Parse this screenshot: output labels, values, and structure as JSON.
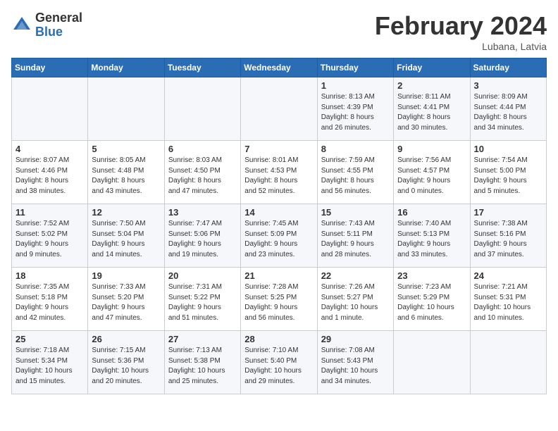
{
  "header": {
    "logo_general": "General",
    "logo_blue": "Blue",
    "month_title": "February 2024",
    "subtitle": "Lubana, Latvia"
  },
  "days_of_week": [
    "Sunday",
    "Monday",
    "Tuesday",
    "Wednesday",
    "Thursday",
    "Friday",
    "Saturday"
  ],
  "weeks": [
    {
      "days": [
        {
          "number": "",
          "info": ""
        },
        {
          "number": "",
          "info": ""
        },
        {
          "number": "",
          "info": ""
        },
        {
          "number": "",
          "info": ""
        },
        {
          "number": "1",
          "info": "Sunrise: 8:13 AM\nSunset: 4:39 PM\nDaylight: 8 hours\nand 26 minutes."
        },
        {
          "number": "2",
          "info": "Sunrise: 8:11 AM\nSunset: 4:41 PM\nDaylight: 8 hours\nand 30 minutes."
        },
        {
          "number": "3",
          "info": "Sunrise: 8:09 AM\nSunset: 4:44 PM\nDaylight: 8 hours\nand 34 minutes."
        }
      ]
    },
    {
      "days": [
        {
          "number": "4",
          "info": "Sunrise: 8:07 AM\nSunset: 4:46 PM\nDaylight: 8 hours\nand 38 minutes."
        },
        {
          "number": "5",
          "info": "Sunrise: 8:05 AM\nSunset: 4:48 PM\nDaylight: 8 hours\nand 43 minutes."
        },
        {
          "number": "6",
          "info": "Sunrise: 8:03 AM\nSunset: 4:50 PM\nDaylight: 8 hours\nand 47 minutes."
        },
        {
          "number": "7",
          "info": "Sunrise: 8:01 AM\nSunset: 4:53 PM\nDaylight: 8 hours\nand 52 minutes."
        },
        {
          "number": "8",
          "info": "Sunrise: 7:59 AM\nSunset: 4:55 PM\nDaylight: 8 hours\nand 56 minutes."
        },
        {
          "number": "9",
          "info": "Sunrise: 7:56 AM\nSunset: 4:57 PM\nDaylight: 9 hours\nand 0 minutes."
        },
        {
          "number": "10",
          "info": "Sunrise: 7:54 AM\nSunset: 5:00 PM\nDaylight: 9 hours\nand 5 minutes."
        }
      ]
    },
    {
      "days": [
        {
          "number": "11",
          "info": "Sunrise: 7:52 AM\nSunset: 5:02 PM\nDaylight: 9 hours\nand 9 minutes."
        },
        {
          "number": "12",
          "info": "Sunrise: 7:50 AM\nSunset: 5:04 PM\nDaylight: 9 hours\nand 14 minutes."
        },
        {
          "number": "13",
          "info": "Sunrise: 7:47 AM\nSunset: 5:06 PM\nDaylight: 9 hours\nand 19 minutes."
        },
        {
          "number": "14",
          "info": "Sunrise: 7:45 AM\nSunset: 5:09 PM\nDaylight: 9 hours\nand 23 minutes."
        },
        {
          "number": "15",
          "info": "Sunrise: 7:43 AM\nSunset: 5:11 PM\nDaylight: 9 hours\nand 28 minutes."
        },
        {
          "number": "16",
          "info": "Sunrise: 7:40 AM\nSunset: 5:13 PM\nDaylight: 9 hours\nand 33 minutes."
        },
        {
          "number": "17",
          "info": "Sunrise: 7:38 AM\nSunset: 5:16 PM\nDaylight: 9 hours\nand 37 minutes."
        }
      ]
    },
    {
      "days": [
        {
          "number": "18",
          "info": "Sunrise: 7:35 AM\nSunset: 5:18 PM\nDaylight: 9 hours\nand 42 minutes."
        },
        {
          "number": "19",
          "info": "Sunrise: 7:33 AM\nSunset: 5:20 PM\nDaylight: 9 hours\nand 47 minutes."
        },
        {
          "number": "20",
          "info": "Sunrise: 7:31 AM\nSunset: 5:22 PM\nDaylight: 9 hours\nand 51 minutes."
        },
        {
          "number": "21",
          "info": "Sunrise: 7:28 AM\nSunset: 5:25 PM\nDaylight: 9 hours\nand 56 minutes."
        },
        {
          "number": "22",
          "info": "Sunrise: 7:26 AM\nSunset: 5:27 PM\nDaylight: 10 hours\nand 1 minute."
        },
        {
          "number": "23",
          "info": "Sunrise: 7:23 AM\nSunset: 5:29 PM\nDaylight: 10 hours\nand 6 minutes."
        },
        {
          "number": "24",
          "info": "Sunrise: 7:21 AM\nSunset: 5:31 PM\nDaylight: 10 hours\nand 10 minutes."
        }
      ]
    },
    {
      "days": [
        {
          "number": "25",
          "info": "Sunrise: 7:18 AM\nSunset: 5:34 PM\nDaylight: 10 hours\nand 15 minutes."
        },
        {
          "number": "26",
          "info": "Sunrise: 7:15 AM\nSunset: 5:36 PM\nDaylight: 10 hours\nand 20 minutes."
        },
        {
          "number": "27",
          "info": "Sunrise: 7:13 AM\nSunset: 5:38 PM\nDaylight: 10 hours\nand 25 minutes."
        },
        {
          "number": "28",
          "info": "Sunrise: 7:10 AM\nSunset: 5:40 PM\nDaylight: 10 hours\nand 29 minutes."
        },
        {
          "number": "29",
          "info": "Sunrise: 7:08 AM\nSunset: 5:43 PM\nDaylight: 10 hours\nand 34 minutes."
        },
        {
          "number": "",
          "info": ""
        },
        {
          "number": "",
          "info": ""
        }
      ]
    }
  ]
}
